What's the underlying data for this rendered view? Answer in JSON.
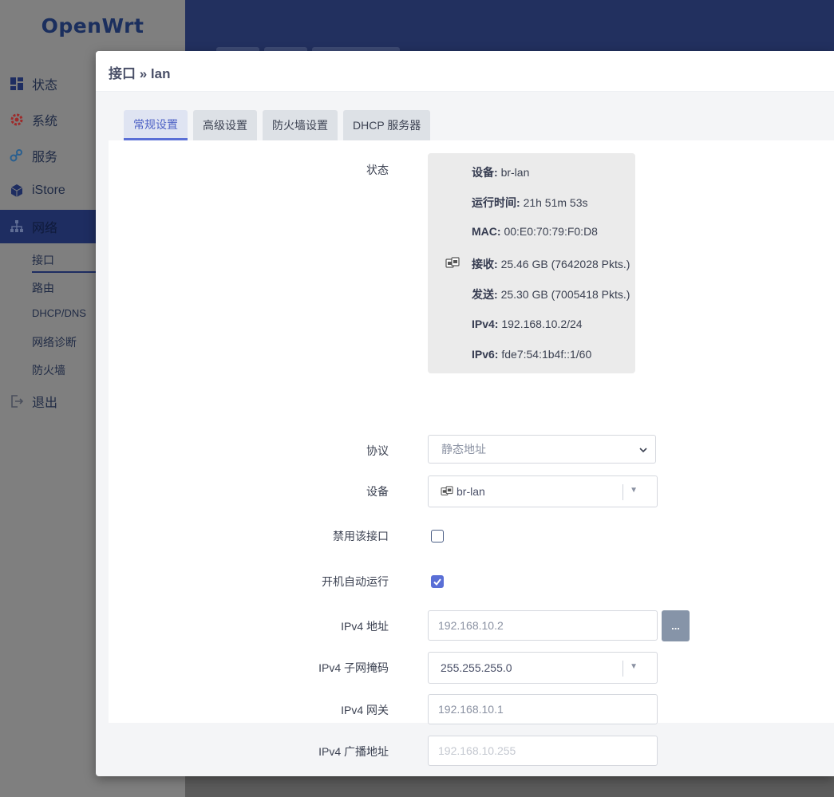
{
  "app": {
    "brand": "OpenWrt"
  },
  "sidebar": {
    "items": [
      {
        "label": "状态",
        "icon": "dashboard-icon"
      },
      {
        "label": "系统",
        "icon": "gear-icon"
      },
      {
        "label": "服务",
        "icon": "services-icon"
      },
      {
        "label": "iStore",
        "icon": "cube-icon"
      },
      {
        "label": "网络",
        "icon": "network-icon"
      },
      {
        "label": "退出",
        "icon": "logout-icon"
      }
    ],
    "network_submenu": [
      "接口",
      "路由",
      "DHCP/DNS",
      "网络诊断",
      "防火墙"
    ]
  },
  "modal": {
    "title": "接口 » lan",
    "tabs": [
      "常规设置",
      "高级设置",
      "防火墙设置",
      "DHCP 服务器"
    ],
    "status": {
      "label": "状态",
      "device_key": "设备:",
      "device_val": "br-lan",
      "uptime_key": "运行时间:",
      "uptime_val": "21h 51m 53s",
      "mac_key": "MAC:",
      "mac_val": "00:E0:70:79:F0:D8",
      "rx_key": "接收:",
      "rx_val": "25.46 GB (7642028 Pkts.)",
      "tx_key": "发送:",
      "tx_val": "25.30 GB (7005418 Pkts.)",
      "ipv4_key": "IPv4:",
      "ipv4_val": "192.168.10.2/24",
      "ipv6_key": "IPv6:",
      "ipv6_val": "fde7:54:1b4f::1/60"
    },
    "protocol": {
      "label": "协议",
      "value": "静态地址"
    },
    "device": {
      "label": "设备",
      "value": "br-lan"
    },
    "disable": {
      "label": "禁用该接口",
      "checked": false
    },
    "autostart": {
      "label": "开机自动运行",
      "checked": true
    },
    "ipv4_addr": {
      "label": "IPv4 地址",
      "value": "192.168.10.2",
      "button": "..."
    },
    "ipv4_mask": {
      "label": "IPv4 子网掩码",
      "value": "255.255.255.0"
    },
    "ipv4_gw": {
      "label": "IPv4 网关",
      "value": "192.168.10.1"
    },
    "ipv4_bcast": {
      "label": "IPv4 广播地址",
      "placeholder": "192.168.10.255"
    }
  },
  "colors": {
    "accent": "#5a6fd6",
    "header": "#22305f"
  }
}
